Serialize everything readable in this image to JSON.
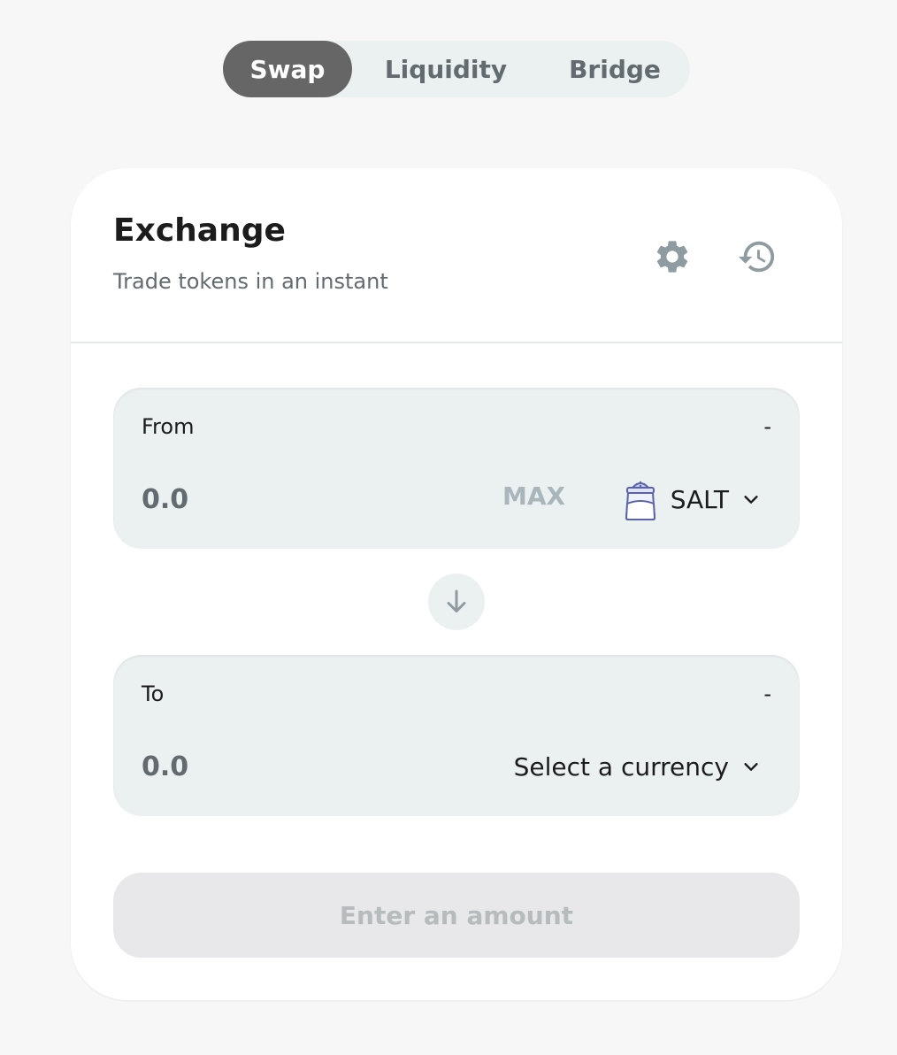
{
  "nav": {
    "tabs": [
      {
        "label": "Swap",
        "active": true
      },
      {
        "label": "Liquidity",
        "active": false
      },
      {
        "label": "Bridge",
        "active": false
      }
    ]
  },
  "exchange": {
    "title": "Exchange",
    "subtitle": "Trade tokens in an instant",
    "icons": {
      "settings": "gear-icon",
      "history": "history-icon"
    }
  },
  "from": {
    "label": "From",
    "balance": "-",
    "amount_placeholder": "0.0",
    "max_label": "MAX",
    "token": {
      "symbol": "SALT",
      "icon": "salt-shaker-icon"
    }
  },
  "swap_direction_icon": "arrow-down-icon",
  "to": {
    "label": "To",
    "balance": "-",
    "amount_placeholder": "0.0",
    "currency_label": "Select a currency"
  },
  "submit": {
    "label": "Enter an amount",
    "disabled": true
  },
  "colors": {
    "background": "#f7f7f7",
    "tab_active": "#666666",
    "panel": "#ebf1f1",
    "text_primary": "#1c1c1c",
    "text_secondary": "#626b70",
    "muted": "#a9b6bb",
    "button_disabled": "#e8e8ea"
  }
}
